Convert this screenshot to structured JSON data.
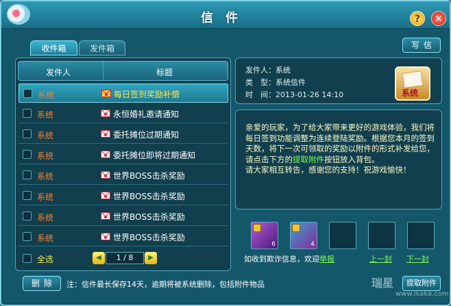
{
  "window": {
    "title": "信件"
  },
  "tabs": [
    {
      "label": "收件箱",
      "active": true
    },
    {
      "label": "发件箱",
      "active": false
    }
  ],
  "toolbar": {
    "write_label": "写信"
  },
  "list": {
    "header_sender": "发件人",
    "header_title": "标题",
    "rows": [
      {
        "sender": "系统",
        "subject": "每日签到奖励补偿",
        "selected": true
      },
      {
        "sender": "系统",
        "subject": "永恒婚礼邀请通知",
        "selected": false
      },
      {
        "sender": "系统",
        "subject": "委托摊位过期通知",
        "selected": false
      },
      {
        "sender": "系统",
        "subject": "委托摊位即将过期通知",
        "selected": false
      },
      {
        "sender": "系统",
        "subject": "世界BOSS击杀奖励",
        "selected": false
      },
      {
        "sender": "系统",
        "subject": "世界BOSS击杀奖励",
        "selected": false
      },
      {
        "sender": "系统",
        "subject": "世界BOSS击杀奖励",
        "selected": false
      },
      {
        "sender": "系统",
        "subject": "世界BOSS击杀奖励",
        "selected": false
      }
    ],
    "select_all": "全选",
    "pager": "1 / 8"
  },
  "info": {
    "sender_label": "发件人：",
    "sender_value": "系统",
    "type_label": "类　型：",
    "type_value": "系统信件",
    "time_label": "时　间：",
    "time_value": "2013-01-26 14:10",
    "icon_label": "系统"
  },
  "body": {
    "part1": "亲爱的玩家，为了给大家带来更好的游戏体验，我们将每日签到功能调整为连续登陆奖励。根据您本月的签到天数，将下一次可领取的奖励以附件的形式补发给您，请点击下方的",
    "link": "提取附件",
    "part2": "按钮放入背包。",
    "part3": "请大家相互转告，感谢您的支持！祝游戏愉快！"
  },
  "attachments": [
    {
      "count": "6"
    },
    {
      "count": "4"
    }
  ],
  "report": {
    "text": "如收到欺诈信息，欢迎",
    "link": "举报"
  },
  "nav": {
    "prev": "上一封",
    "next": "下一封"
  },
  "footer": {
    "delete_label": "删除",
    "note": "注：信件最长保存14天，逾期将被系统删除，包括附件物品",
    "extract_label": "提取附件"
  },
  "watermark": {
    "brand": "瑞星",
    "url": "www.ikaka.com"
  },
  "colors": {
    "sender": "#ff7f2a",
    "selected_subject": "#ffe95a",
    "link": "#7cff4e",
    "body_text": "#fff9c8"
  }
}
